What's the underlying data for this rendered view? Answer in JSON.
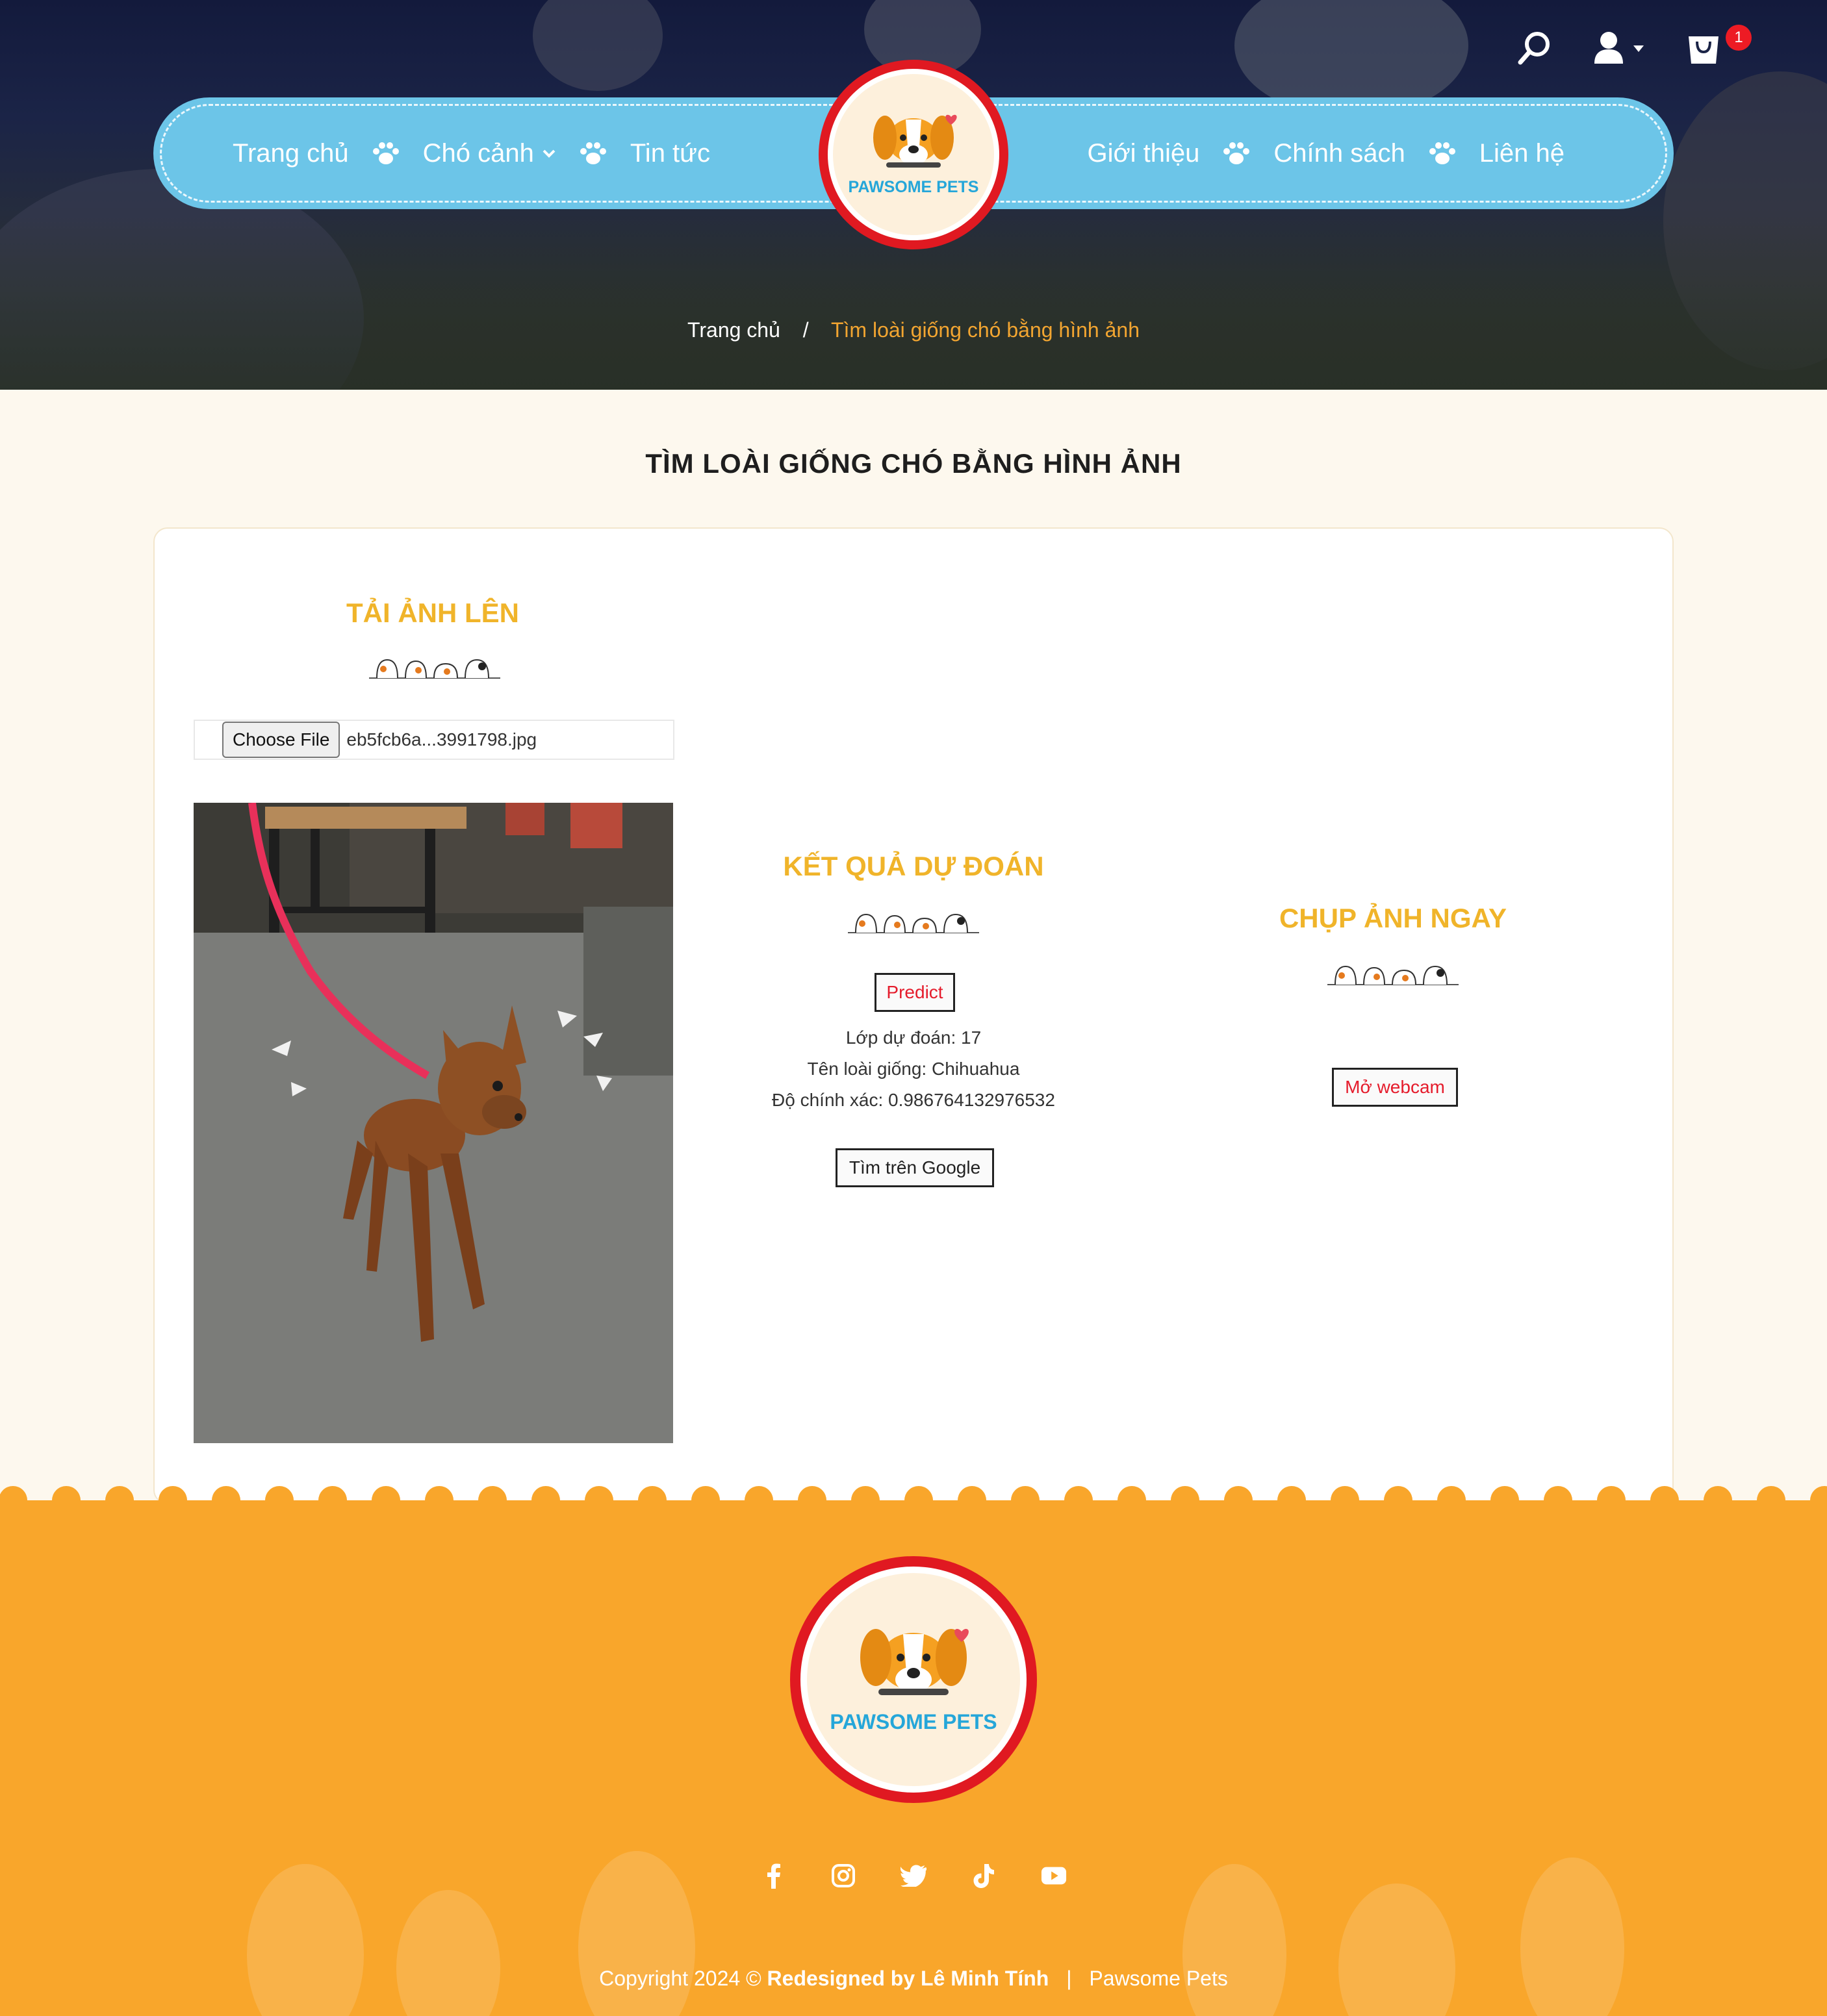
{
  "nav": {
    "left_items": [
      "Trang chủ",
      "Chó cảnh",
      "Tin tức"
    ],
    "right_items": [
      "Giới thiệu",
      "Chính sách",
      "Liên hệ"
    ]
  },
  "header": {
    "cart_count": "1"
  },
  "brand": {
    "name": "PAWSOME PETS"
  },
  "breadcrumb": {
    "home": "Trang chủ",
    "separator": "/",
    "current": "Tìm loài giống chó bằng hình ảnh"
  },
  "page": {
    "title": "TÌM LOÀI GIỐNG CHÓ BẰNG HÌNH ẢNH"
  },
  "upload": {
    "title": "TẢI ẢNH LÊN",
    "choose_file_label": "Choose File",
    "file_name": "eb5fcb6a...3991798.jpg"
  },
  "result": {
    "title": "KẾT QUẢ DỰ ĐOÁN",
    "predict_label": "Predict",
    "class_line": "Lớp dự đoán: 17",
    "breed_line": "Tên loài giống: Chihuahua",
    "accuracy_line": "Độ chính xác: 0.986764132976532",
    "google_label": "Tìm trên Google"
  },
  "webcam": {
    "title": "CHỤP ẢNH NGAY",
    "open_label": "Mở webcam"
  },
  "footer": {
    "copyright_prefix": "Copyright 2024 ©",
    "copyright_credit": "Redesigned by Lê Minh Tính",
    "separator": "|",
    "brand": "Pawsome Pets",
    "social": [
      "facebook-icon",
      "instagram-icon",
      "twitter-icon",
      "tiktok-icon",
      "youtube-icon"
    ]
  },
  "colors": {
    "nav_blue": "#6cc5e8",
    "accent_orange": "#f9a62b",
    "heading_yellow": "#f0b42a",
    "badge_red": "#ed1b24",
    "button_text_red": "#e51c2c"
  }
}
